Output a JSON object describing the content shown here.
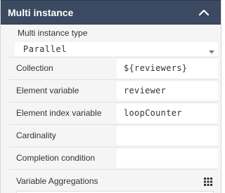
{
  "section": {
    "title": "Multi instance",
    "collapse_icon": "chevron-up-icon",
    "header_color": "#3b4a61"
  },
  "multi_instance_type": {
    "label": "Multi instance type",
    "selected": "Parallel",
    "caret_icon": "caret-down-icon"
  },
  "fields": [
    {
      "label": "Collection",
      "value": "${reviewers}"
    },
    {
      "label": "Element variable",
      "value": "reviewer"
    },
    {
      "label": "Element index variable",
      "value": "loopCounter"
    },
    {
      "label": "Cardinality",
      "value": ""
    },
    {
      "label": "Completion condition",
      "value": ""
    }
  ],
  "aggregations": {
    "label": "Variable Aggregations",
    "icon": "grid-icon"
  }
}
